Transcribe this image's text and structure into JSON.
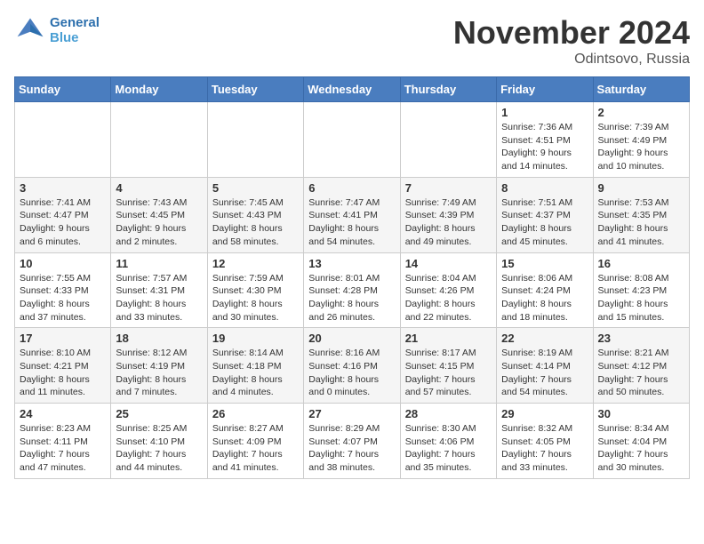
{
  "header": {
    "logo_line1": "General",
    "logo_line2": "Blue",
    "month": "November 2024",
    "location": "Odintsovo, Russia"
  },
  "weekdays": [
    "Sunday",
    "Monday",
    "Tuesday",
    "Wednesday",
    "Thursday",
    "Friday",
    "Saturday"
  ],
  "weeks": [
    [
      {
        "day": "",
        "info": ""
      },
      {
        "day": "",
        "info": ""
      },
      {
        "day": "",
        "info": ""
      },
      {
        "day": "",
        "info": ""
      },
      {
        "day": "",
        "info": ""
      },
      {
        "day": "1",
        "info": "Sunrise: 7:36 AM\nSunset: 4:51 PM\nDaylight: 9 hours\nand 14 minutes."
      },
      {
        "day": "2",
        "info": "Sunrise: 7:39 AM\nSunset: 4:49 PM\nDaylight: 9 hours\nand 10 minutes."
      }
    ],
    [
      {
        "day": "3",
        "info": "Sunrise: 7:41 AM\nSunset: 4:47 PM\nDaylight: 9 hours\nand 6 minutes."
      },
      {
        "day": "4",
        "info": "Sunrise: 7:43 AM\nSunset: 4:45 PM\nDaylight: 9 hours\nand 2 minutes."
      },
      {
        "day": "5",
        "info": "Sunrise: 7:45 AM\nSunset: 4:43 PM\nDaylight: 8 hours\nand 58 minutes."
      },
      {
        "day": "6",
        "info": "Sunrise: 7:47 AM\nSunset: 4:41 PM\nDaylight: 8 hours\nand 54 minutes."
      },
      {
        "day": "7",
        "info": "Sunrise: 7:49 AM\nSunset: 4:39 PM\nDaylight: 8 hours\nand 49 minutes."
      },
      {
        "day": "8",
        "info": "Sunrise: 7:51 AM\nSunset: 4:37 PM\nDaylight: 8 hours\nand 45 minutes."
      },
      {
        "day": "9",
        "info": "Sunrise: 7:53 AM\nSunset: 4:35 PM\nDaylight: 8 hours\nand 41 minutes."
      }
    ],
    [
      {
        "day": "10",
        "info": "Sunrise: 7:55 AM\nSunset: 4:33 PM\nDaylight: 8 hours\nand 37 minutes."
      },
      {
        "day": "11",
        "info": "Sunrise: 7:57 AM\nSunset: 4:31 PM\nDaylight: 8 hours\nand 33 minutes."
      },
      {
        "day": "12",
        "info": "Sunrise: 7:59 AM\nSunset: 4:30 PM\nDaylight: 8 hours\nand 30 minutes."
      },
      {
        "day": "13",
        "info": "Sunrise: 8:01 AM\nSunset: 4:28 PM\nDaylight: 8 hours\nand 26 minutes."
      },
      {
        "day": "14",
        "info": "Sunrise: 8:04 AM\nSunset: 4:26 PM\nDaylight: 8 hours\nand 22 minutes."
      },
      {
        "day": "15",
        "info": "Sunrise: 8:06 AM\nSunset: 4:24 PM\nDaylight: 8 hours\nand 18 minutes."
      },
      {
        "day": "16",
        "info": "Sunrise: 8:08 AM\nSunset: 4:23 PM\nDaylight: 8 hours\nand 15 minutes."
      }
    ],
    [
      {
        "day": "17",
        "info": "Sunrise: 8:10 AM\nSunset: 4:21 PM\nDaylight: 8 hours\nand 11 minutes."
      },
      {
        "day": "18",
        "info": "Sunrise: 8:12 AM\nSunset: 4:19 PM\nDaylight: 8 hours\nand 7 minutes."
      },
      {
        "day": "19",
        "info": "Sunrise: 8:14 AM\nSunset: 4:18 PM\nDaylight: 8 hours\nand 4 minutes."
      },
      {
        "day": "20",
        "info": "Sunrise: 8:16 AM\nSunset: 4:16 PM\nDaylight: 8 hours\nand 0 minutes."
      },
      {
        "day": "21",
        "info": "Sunrise: 8:17 AM\nSunset: 4:15 PM\nDaylight: 7 hours\nand 57 minutes."
      },
      {
        "day": "22",
        "info": "Sunrise: 8:19 AM\nSunset: 4:14 PM\nDaylight: 7 hours\nand 54 minutes."
      },
      {
        "day": "23",
        "info": "Sunrise: 8:21 AM\nSunset: 4:12 PM\nDaylight: 7 hours\nand 50 minutes."
      }
    ],
    [
      {
        "day": "24",
        "info": "Sunrise: 8:23 AM\nSunset: 4:11 PM\nDaylight: 7 hours\nand 47 minutes."
      },
      {
        "day": "25",
        "info": "Sunrise: 8:25 AM\nSunset: 4:10 PM\nDaylight: 7 hours\nand 44 minutes."
      },
      {
        "day": "26",
        "info": "Sunrise: 8:27 AM\nSunset: 4:09 PM\nDaylight: 7 hours\nand 41 minutes."
      },
      {
        "day": "27",
        "info": "Sunrise: 8:29 AM\nSunset: 4:07 PM\nDaylight: 7 hours\nand 38 minutes."
      },
      {
        "day": "28",
        "info": "Sunrise: 8:30 AM\nSunset: 4:06 PM\nDaylight: 7 hours\nand 35 minutes."
      },
      {
        "day": "29",
        "info": "Sunrise: 8:32 AM\nSunset: 4:05 PM\nDaylight: 7 hours\nand 33 minutes."
      },
      {
        "day": "30",
        "info": "Sunrise: 8:34 AM\nSunset: 4:04 PM\nDaylight: 7 hours\nand 30 minutes."
      }
    ]
  ]
}
